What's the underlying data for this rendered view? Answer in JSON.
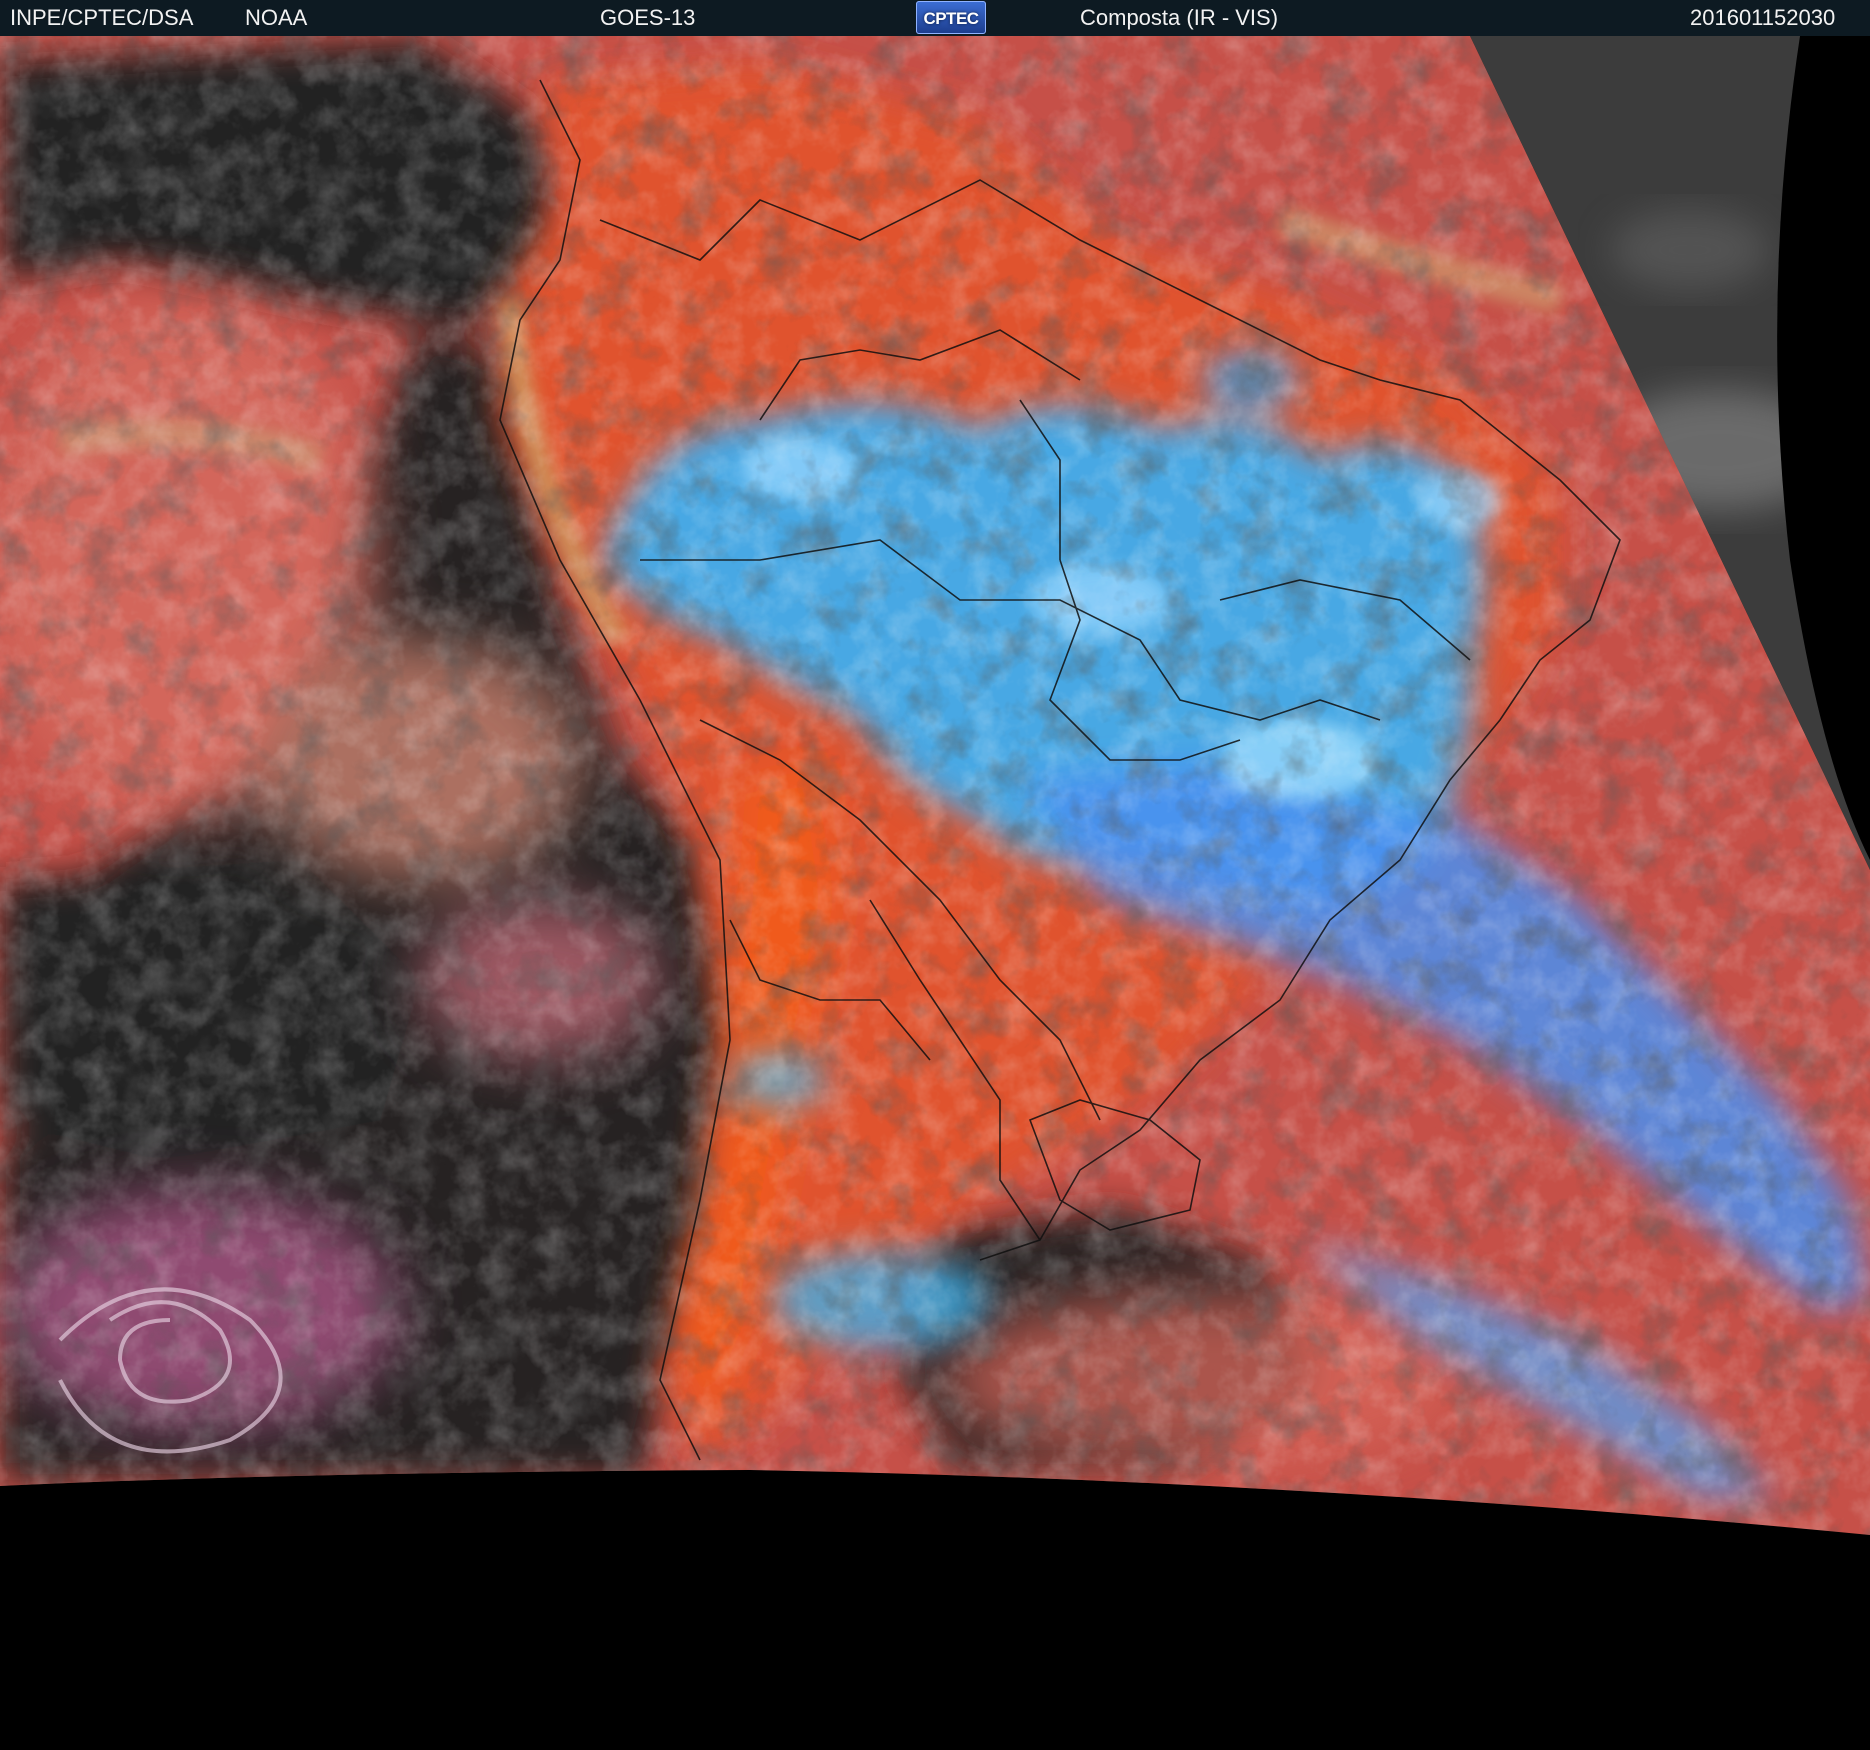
{
  "header": {
    "org": "INPE/CPTEC/DSA",
    "agency": "NOAA",
    "satellite": "GOES-13",
    "product": "Composta (IR - VIS)",
    "timestamp": "201601152030"
  },
  "logo": {
    "text": "CPTEC"
  },
  "colors": {
    "header_bg": "#0d1a22",
    "ocean_clear": "#202020",
    "low_cloud_red": "#c8504a",
    "land_orange": "#e2552e",
    "deep_convection_cyan": "#3aa8f0",
    "outside_disk": "#000000",
    "visible_gray": "#4a4a4a"
  }
}
